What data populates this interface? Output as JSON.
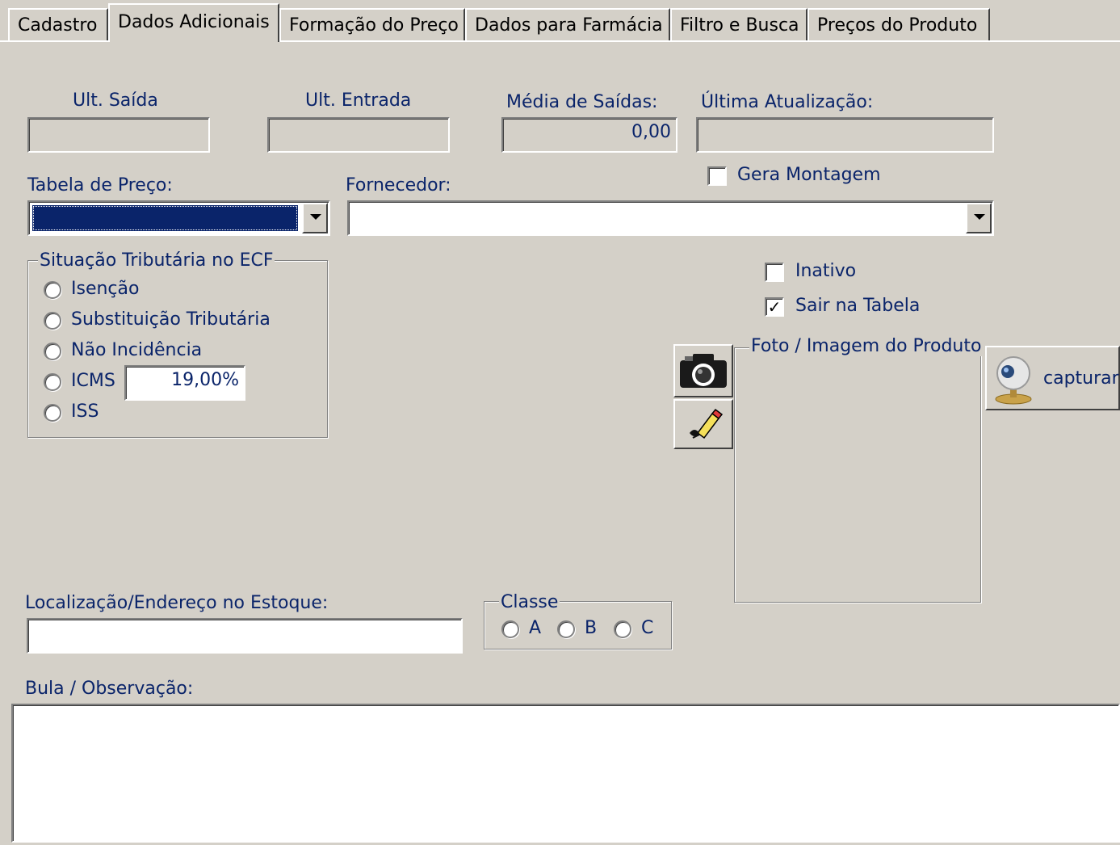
{
  "tabs": [
    "Cadastro",
    "Dados Adicionais",
    "Formação do Preço",
    "Dados para Farmácia",
    "Filtro e Busca",
    "Preços do Produto"
  ],
  "fields": {
    "ult_saida": {
      "label": "Ult. Saída",
      "value": ""
    },
    "ult_entrada": {
      "label": "Ult. Entrada",
      "value": ""
    },
    "media_saidas": {
      "label": "Média de Saídas:",
      "value": "0,00"
    },
    "ultima_atualizacao": {
      "label": "Última Atualização:",
      "value": ""
    },
    "tabela_preco": {
      "label": "Tabela de Preço:",
      "value": ""
    },
    "fornecedor": {
      "label": "Fornecedor:",
      "value": ""
    },
    "localizacao": {
      "label": "Localização/Endereço no Estoque:",
      "value": ""
    },
    "bula": {
      "label": "Bula / Observação:",
      "value": ""
    }
  },
  "checkboxes": {
    "gera_montagem": {
      "label": "Gera Montagem",
      "checked": false
    },
    "inativo": {
      "label": "Inativo",
      "checked": false
    },
    "sair_na_tabela": {
      "label": "Sair na Tabela",
      "checked": true
    }
  },
  "situacao": {
    "title": "Situação Tributária no ECF",
    "options": [
      "Isenção",
      "Substituição Tributária",
      "Não Incidência",
      "ICMS",
      "ISS"
    ],
    "icms_value": "19,00%"
  },
  "classe": {
    "title": "Classe",
    "options": [
      "A",
      "B",
      "C"
    ]
  },
  "foto": {
    "title": "Foto / Imagem do Produto",
    "capture_label": "capturar"
  },
  "icons": [
    "camera-icon",
    "eraser-icon",
    "webcam-icon",
    "chevron-down-icon"
  ],
  "colors": {
    "label": "#0a246a",
    "selection": "#0a246a",
    "face": "#d4d0c8"
  }
}
